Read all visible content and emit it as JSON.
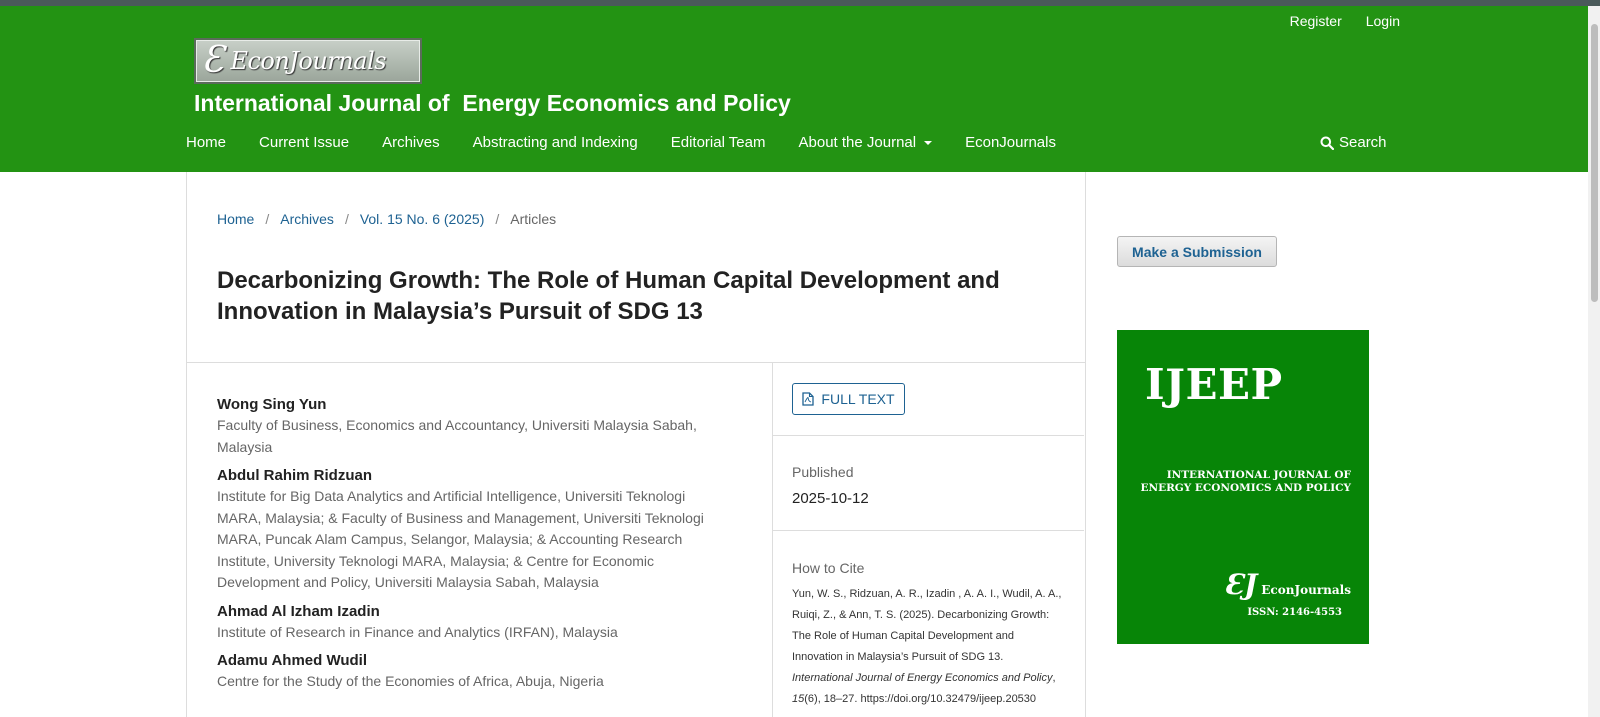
{
  "header": {
    "user_nav": [
      "Register",
      "Login"
    ],
    "logo_mark": "Ɛ",
    "logo_text": "EconJournals",
    "site_title": "International Journal of  Energy Economics and Policy",
    "primary_nav": [
      "Home",
      "Current Issue",
      "Archives",
      "Abstracting and Indexing",
      "Editorial Team",
      "About the Journal",
      "EconJournals"
    ],
    "search_label": "Search"
  },
  "breadcrumb": {
    "items": [
      "Home",
      "Archives",
      "Vol. 15 No. 6 (2025)"
    ],
    "current": "Articles",
    "separator": "/"
  },
  "article": {
    "title": "Decarbonizing Growth: The Role of Human Capital Development and Innovation in Malaysia’s Pursuit of SDG 13",
    "authors": [
      {
        "name": "Wong Sing Yun",
        "affiliation": "Faculty of Business, Economics and Accountancy, Universiti Malaysia Sabah, Malaysia"
      },
      {
        "name": "Abdul Rahim Ridzuan",
        "affiliation": "Institute for Big Data Analytics and Artificial Intelligence, Universiti Teknologi MARA, Malaysia; & Faculty of Business and Management, Universiti Teknologi MARA, Puncak Alam Campus, Selangor, Malaysia; & Accounting Research Institute, University Teknologi MARA, Malaysia; & Centre for Economic Development and Policy, Universiti Malaysia Sabah, Malaysia"
      },
      {
        "name": "Ahmad Al Izham Izadin",
        "affiliation": "Institute of Research in Finance and Analytics (IRFAN), Malaysia"
      },
      {
        "name": "Adamu Ahmed Wudil",
        "affiliation": "Centre for the Study of the Economies of Africa, Abuja, Nigeria"
      }
    ],
    "full_text_label": "FULL TEXT",
    "published_label": "Published",
    "published_date": "2025-10-12",
    "cite_label": "How to Cite",
    "cite_main": "Yun, W. S., Ridzuan, A. R., Izadin , A. A. I., Wudil, A. A., Ruiqi, Z., & Ann, T. S. (2025). Decarbonizing Growth: The Role of Human Capital Development and Innovation in Malaysia’s Pursuit of SDG 13. ",
    "cite_journal": "International Journal of Energy Economics and Policy",
    "cite_sep": ", ",
    "cite_volume": "15",
    "cite_tail": "(6), 18–27. https://doi.org/10.32479/ijeep.20530"
  },
  "sidebar": {
    "submit_label": "Make a Submission",
    "cover": {
      "abbr": "IJEEP",
      "full_line1": "INTERNATIONAL JOURNAL OF",
      "full_line2": "ENERGY ECONOMICS AND POLICY",
      "ej_mark": "ƐJ",
      "ej_word": "EconJournals",
      "issn": "ISSN: 2146-4553"
    }
  },
  "colors": {
    "header_green": "#239313",
    "link_blue": "#1e6292",
    "cover_green": "#078507"
  }
}
